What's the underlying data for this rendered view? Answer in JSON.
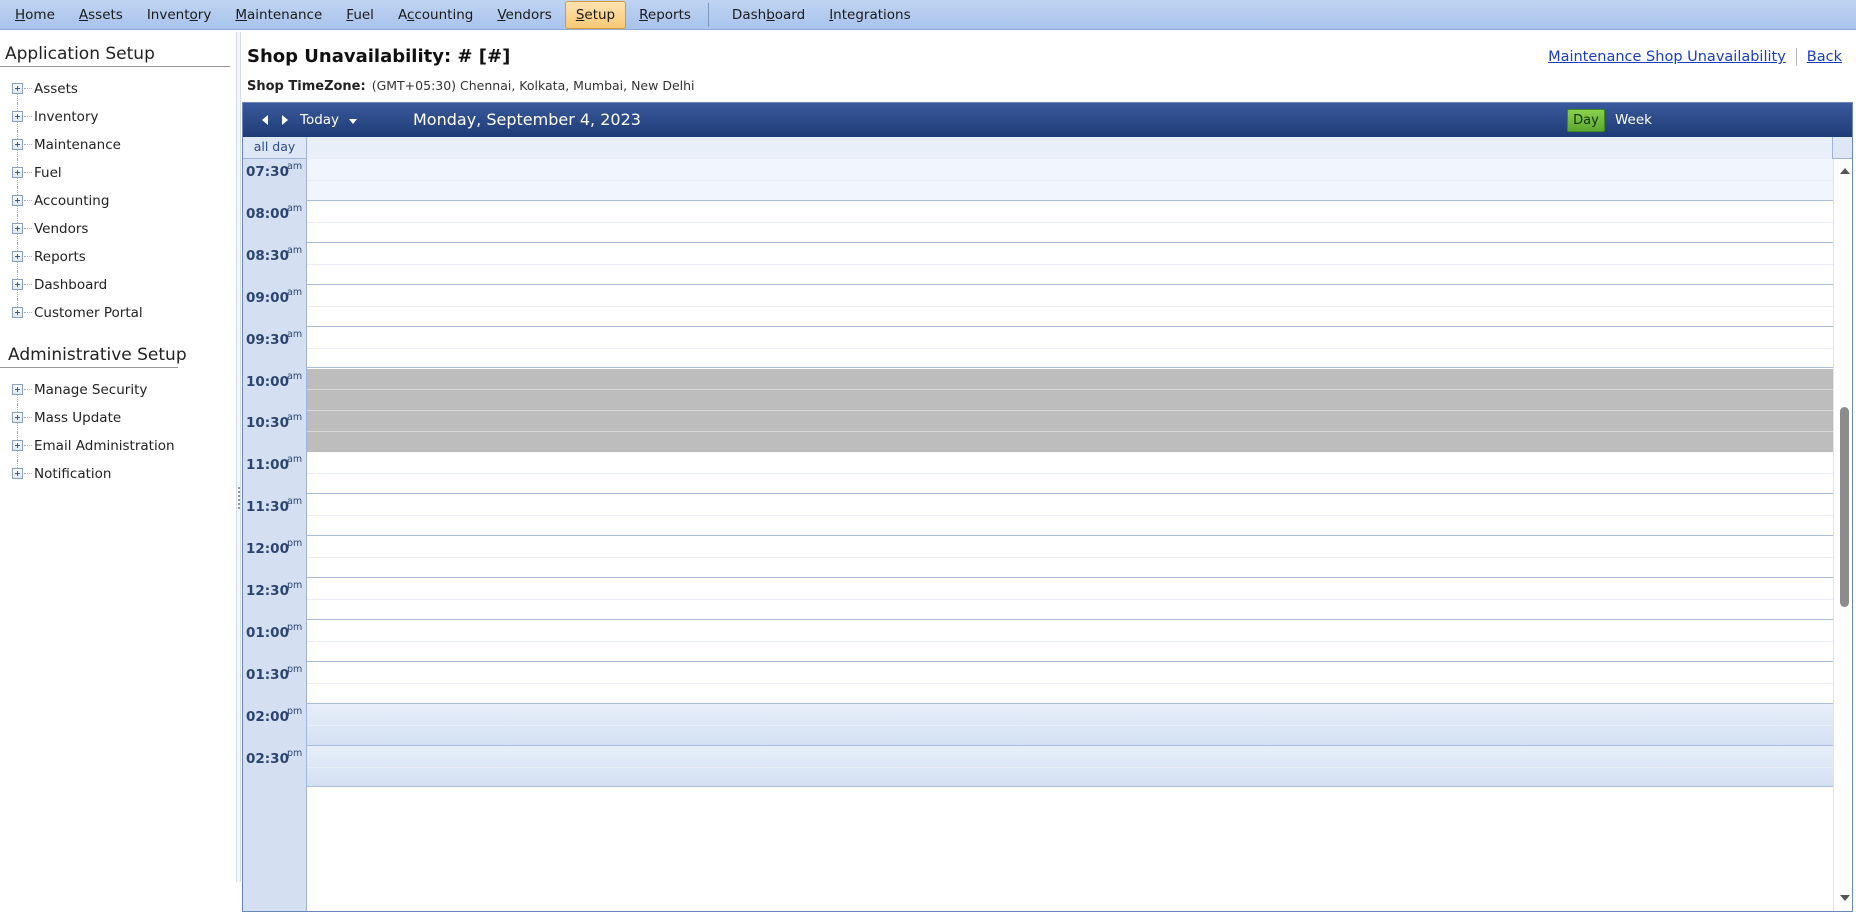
{
  "menu": {
    "items": [
      {
        "pre": "",
        "ul": "H",
        "post": "ome",
        "active": false
      },
      {
        "pre": "",
        "ul": "A",
        "post": "ssets",
        "active": false
      },
      {
        "pre": "Invent",
        "ul": "o",
        "post": "ry",
        "active": false
      },
      {
        "pre": "",
        "ul": "M",
        "post": "aintenance",
        "active": false
      },
      {
        "pre": "",
        "ul": "F",
        "post": "uel",
        "active": false
      },
      {
        "pre": "A",
        "ul": "c",
        "post": "counting",
        "active": false
      },
      {
        "pre": "",
        "ul": "V",
        "post": "endors",
        "active": false
      },
      {
        "pre": "",
        "ul": "S",
        "post": "etup",
        "active": true
      },
      {
        "pre": "",
        "ul": "R",
        "post": "eports",
        "active": false
      }
    ],
    "secondary": [
      {
        "pre": "Dash",
        "ul": "b",
        "post": "oard"
      },
      {
        "pre": "",
        "ul": "I",
        "post": "ntegrations"
      }
    ]
  },
  "sidebar": {
    "application_setup": {
      "heading": "Application Setup",
      "items": [
        "Assets",
        "Inventory",
        "Maintenance",
        "Fuel",
        "Accounting",
        "Vendors",
        "Reports",
        "Dashboard",
        "Customer Portal"
      ]
    },
    "administrative_setup": {
      "heading": "Administrative Setup",
      "items": [
        "Manage Security",
        "Mass Update",
        "Email Administration",
        "Notification"
      ]
    }
  },
  "header": {
    "title": "Shop Unavailability: # [#]",
    "timezone_label": "Shop TimeZone:",
    "timezone_value": "(GMT+05:30) Chennai, Kolkata, Mumbai, New Delhi",
    "link_maintenance": "Maintenance Shop Unavailability",
    "link_back": "Back"
  },
  "scheduler": {
    "today_label": "Today",
    "date_title": "Monday, September 4, 2023",
    "view_day": "Day",
    "view_week": "Week",
    "all_day_label": "all day",
    "slots": [
      {
        "time": "07:30",
        "ampm": "am"
      },
      {
        "time": "08:00",
        "ampm": "am"
      },
      {
        "time": "08:30",
        "ampm": "am"
      },
      {
        "time": "09:00",
        "ampm": "am"
      },
      {
        "time": "09:30",
        "ampm": "am"
      },
      {
        "time": "10:00",
        "ampm": "am"
      },
      {
        "time": "10:30",
        "ampm": "am"
      },
      {
        "time": "11:00",
        "ampm": "am"
      },
      {
        "time": "11:30",
        "ampm": "am"
      },
      {
        "time": "12:00",
        "ampm": "pm"
      },
      {
        "time": "12:30",
        "ampm": "pm"
      },
      {
        "time": "01:00",
        "ampm": "pm"
      },
      {
        "time": "01:30",
        "ampm": "pm"
      },
      {
        "time": "02:00",
        "ampm": "pm"
      },
      {
        "time": "02:30",
        "ampm": "pm"
      }
    ],
    "unavailable_block": {
      "start": "10:00 am",
      "end": "11:00 am"
    }
  },
  "colors": {
    "menubar": "#a9c3ec",
    "active_menu": "#f7c976",
    "toolbar": "#1f3b76",
    "day_button": "#5aa72b",
    "unavailable": "#bdbdbd",
    "link": "#1a3ec0"
  }
}
